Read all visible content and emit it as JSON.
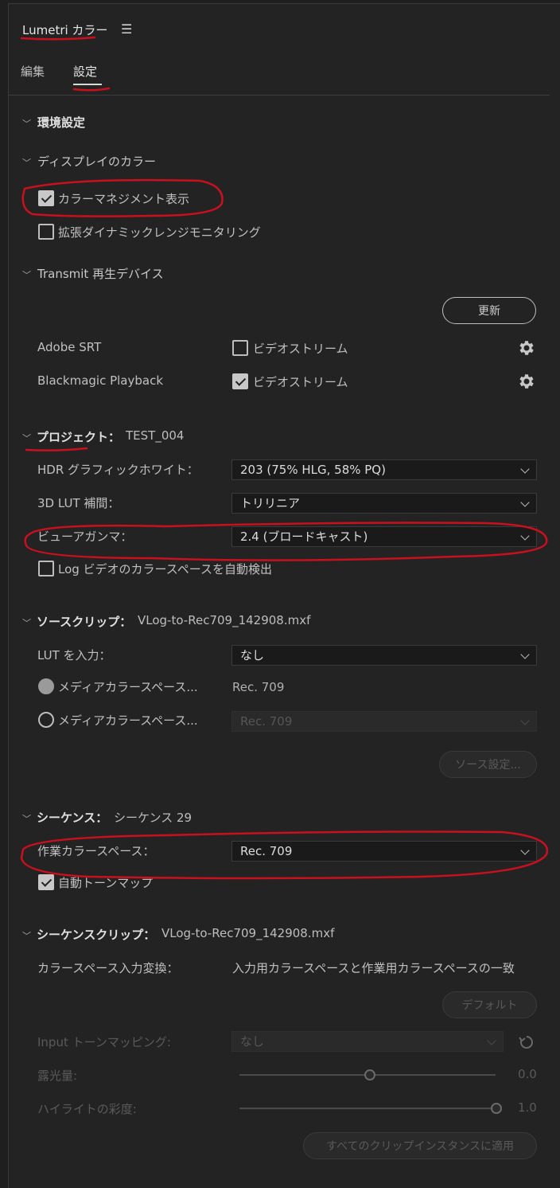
{
  "header": {
    "title": "Lumetri カラー",
    "menu_icon": "hamburger-icon"
  },
  "tabs": [
    {
      "label": "編集",
      "active": false
    },
    {
      "label": "設定",
      "active": true
    }
  ],
  "preferences": {
    "title": "環境設定"
  },
  "display_color": {
    "title": "ディスプレイのカラー",
    "color_management": {
      "label": "カラーマネジメント表示",
      "checked": true
    },
    "extended_dynamic": {
      "label": "拡張ダイナミックレンジモニタリング",
      "checked": false
    }
  },
  "transmit": {
    "title": "Transmit 再生デバイス",
    "refresh_label": "更新",
    "devices": [
      {
        "name": "Adobe SRT",
        "stream_label": "ビデオストリーム",
        "checked": false
      },
      {
        "name": "Blackmagic Playback",
        "stream_label": "ビデオストリーム",
        "checked": true
      }
    ]
  },
  "project": {
    "title": "プロジェクト：",
    "name": "TEST_004",
    "hdr_label": "HDR グラフィックホワイト：",
    "hdr_value": "203 (75% HLG, 58% PQ)",
    "lut_label": "3D LUT 補間：",
    "lut_value": "トリリニア",
    "gamma_label": "ビューアガンマ：",
    "gamma_value": "2.4 (ブロードキャスト)",
    "log_detect": {
      "label": "Log ビデオのカラースペースを自動検出",
      "checked": false
    }
  },
  "source_clip": {
    "title": "ソースクリップ：",
    "name": "VLog-to-Rec709_142908.mxf",
    "lut_input_label": "LUT を入力：",
    "lut_input_value": "なし",
    "media_cs_label_1": "メディアカラースペース...",
    "media_cs_value_1": "Rec. 709",
    "media_cs_label_2": "メディアカラースペース...",
    "media_cs_value_2": "Rec. 709",
    "source_settings_label": "ソース設定..."
  },
  "sequence": {
    "title": "シーケンス：",
    "name": "シーケンス 29",
    "working_cs_label": "作業カラースペース：",
    "working_cs_value": "Rec. 709",
    "auto_tonemap": {
      "label": "自動トーンマップ",
      "checked": true
    }
  },
  "sequence_clip": {
    "title": "シーケンスクリップ：",
    "name": "VLog-to-Rec709_142908.mxf",
    "cs_input_label": "カラースペース入力変換：",
    "cs_input_value": "入力用カラースペースと作業用カラースペースの一致",
    "default_label": "デフォルト",
    "input_tonemap_label": "Input トーンマッピング:",
    "input_tonemap_value": "なし",
    "exposure_label": "露光量:",
    "exposure_value": "0.0",
    "exposure_level": 0.5,
    "highlight_label": "ハイライトの彩度:",
    "highlight_value": "1.0",
    "highlight_level": 1.0,
    "apply_all_label": "すべてのクリップインスタンスに適用"
  },
  "colors": {
    "annotation_red": "#c8101e",
    "panel_bg": "#232323"
  }
}
